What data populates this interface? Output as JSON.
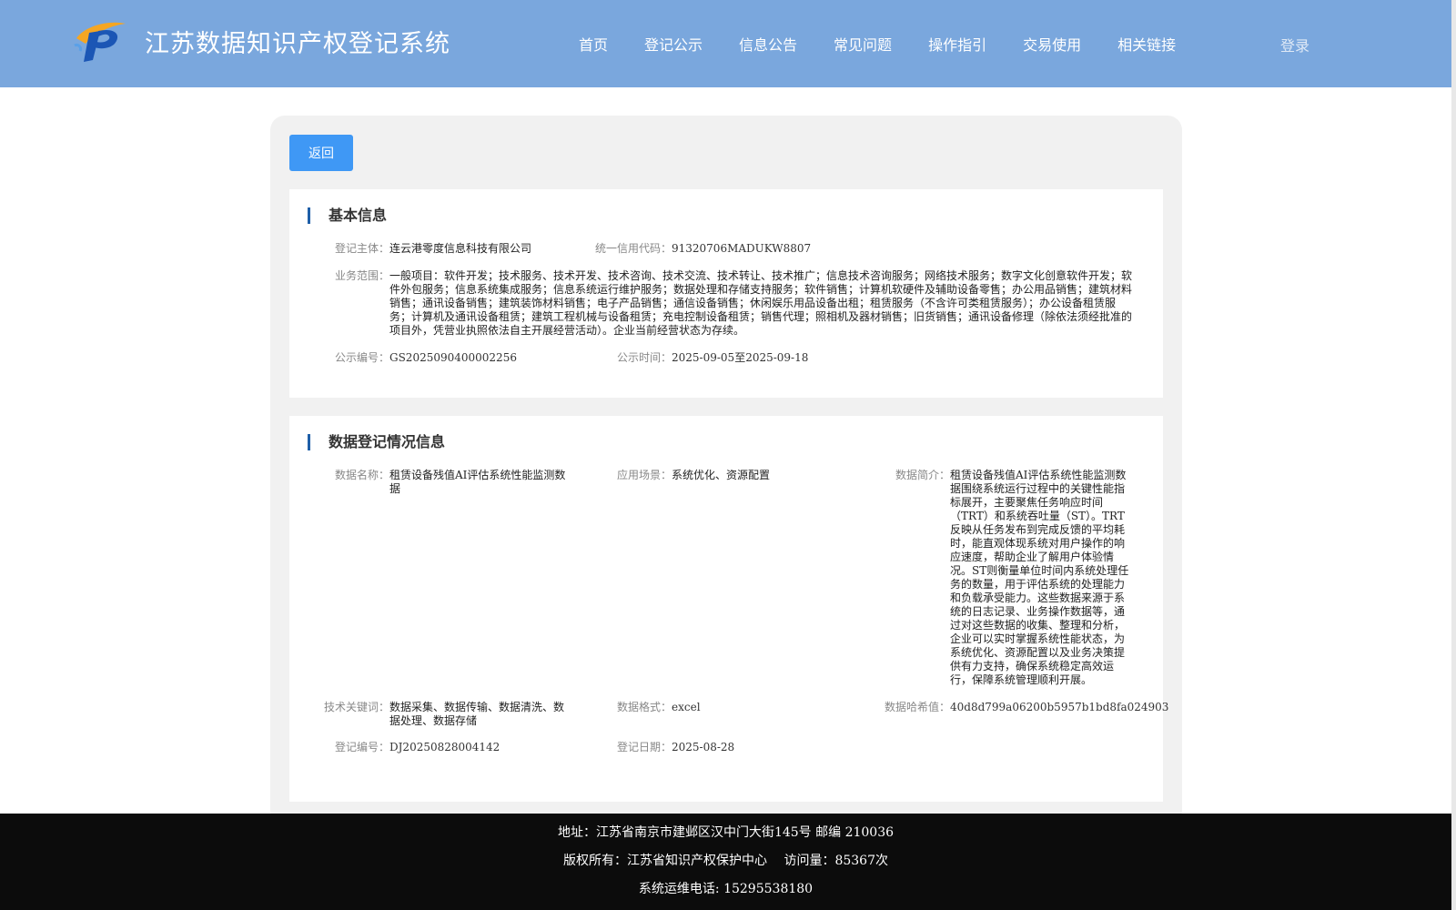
{
  "header": {
    "site_title": "江苏数据知识产权登记系统",
    "nav": [
      "首页",
      "登记公示",
      "信息公告",
      "常见问题",
      "操作指引",
      "交易使用",
      "相关链接"
    ],
    "login": "登录",
    "logo_icon": "ip-logo-icon"
  },
  "toolbar": {
    "back_label": "返回"
  },
  "basic_info": {
    "title": "基本信息",
    "subject_label": "登记主体：",
    "subject_value": "连云港零度信息科技有限公司",
    "credit_label": "统一信用代码：",
    "credit_value": "91320706MADUKW8807",
    "scope_label": "业务范围：",
    "scope_value": "一般项目：软件开发；技术服务、技术开发、技术咨询、技术交流、技术转让、技术推广；信息技术咨询服务；网络技术服务；数字文化创意软件开发；软件外包服务；信息系统集成服务；信息系统运行维护服务；数据处理和存储支持服务；软件销售；计算机软硬件及辅助设备零售；办公用品销售；建筑材料销售；通讯设备销售；建筑装饰材料销售；电子产品销售；通信设备销售；休闲娱乐用品设备出租；租赁服务（不含许可类租赁服务）；办公设备租赁服务；计算机及通讯设备租赁；建筑工程机械与设备租赁；充电控制设备租赁；销售代理；照相机及器材销售；旧货销售；通讯设备修理（除依法须经批准的项目外，凭营业执照依法自主开展经营活动）。企业当前经营状态为存续。",
    "notice_no_label": "公示编号：",
    "notice_no_value": "GS2025090400002256",
    "notice_time_label": "公示时间：",
    "notice_time_value": "2025-09-05至2025-09-18"
  },
  "data_info": {
    "title": "数据登记情况信息",
    "name_label": "数据名称：",
    "name_value": "租赁设备残值AI评估系统性能监测数据",
    "scene_label": "应用场景：",
    "scene_value": "系统优化、资源配置",
    "intro_label": "数据简介：",
    "intro_value": "租赁设备残值AI评估系统性能监测数据围绕系统运行过程中的关键性能指标展开，主要聚焦任务响应时间（TRT）和系统吞吐量（ST）。TRT反映从任务发布到完成反馈的平均耗时，能直观体现系统对用户操作的响应速度，帮助企业了解用户体验情况。ST则衡量单位时间内系统处理任务的数量，用于评估系统的处理能力和负载承受能力。这些数据来源于系统的日志记录、业务操作数据等，通过对这些数据的收集、整理和分析，企业可以实时掌握系统性能状态，为系统优化、资源配置以及业务决策提供有力支持，确保系统稳定高效运行，保障系统管理顺利开展。",
    "keywords_label": "技术关键词：",
    "keywords_value": "数据采集、数据传输、数据清洗、数据处理、数据存储",
    "format_label": "数据格式：",
    "format_value": "excel",
    "hash_label": "数据哈希值：",
    "hash_value": "40d8d799a06200b5957b1bd8fa024903",
    "reg_no_label": "登记编号：",
    "reg_no_value": "DJ20250828004142",
    "reg_date_label": "登记日期：",
    "reg_date_value": "2025-08-28"
  },
  "footer": {
    "address": "地址：江苏省南京市建邺区汉中门大街145号 邮编 210036",
    "copyright": "版权所有：江苏省知识产权保护中心　 访问量：85367次",
    "phone": "系统运维电话: 15295538180"
  }
}
